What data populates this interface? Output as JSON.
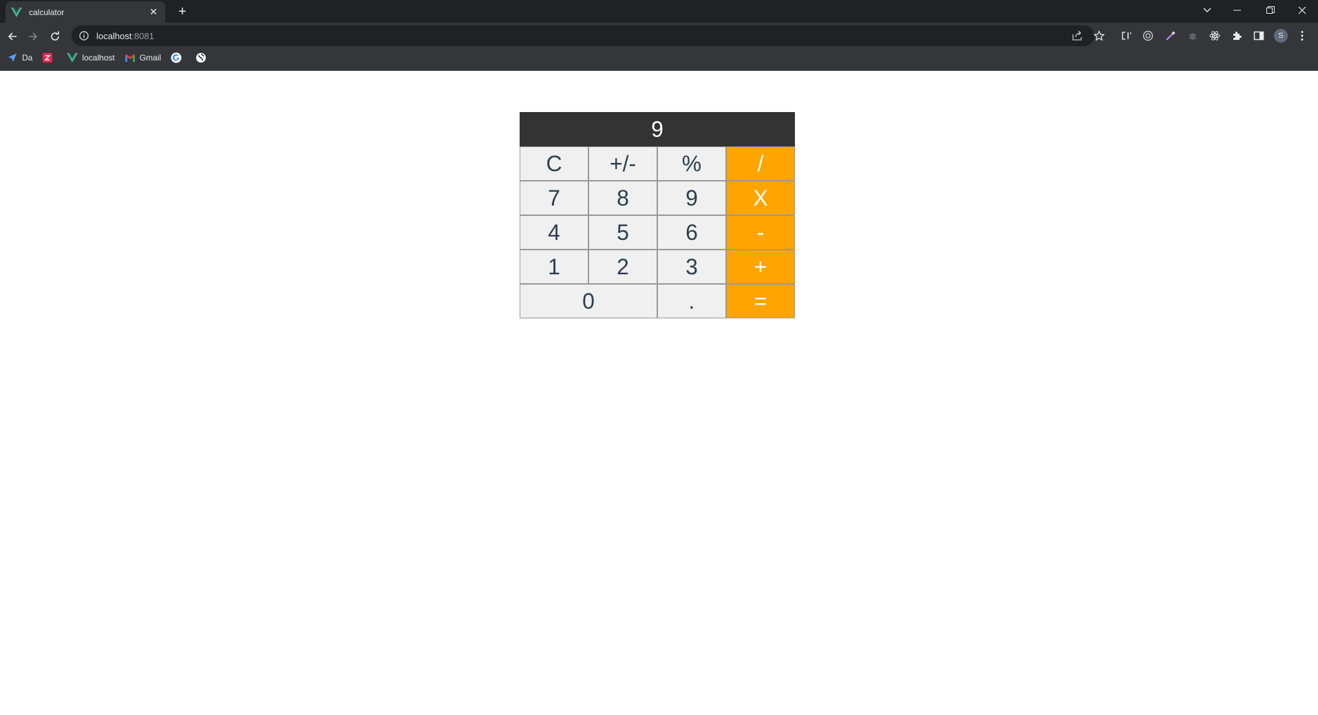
{
  "browser": {
    "tab": {
      "title": "calculator"
    },
    "address": {
      "host": "localhost",
      "port": ":8081"
    },
    "bookmarks": [
      {
        "label": "Da",
        "icon": "navigation-icon"
      },
      {
        "label": "",
        "icon": "z-app-icon"
      },
      {
        "label": "localhost",
        "icon": "vue-icon"
      },
      {
        "label": "Gmail",
        "icon": "gmail-icon"
      },
      {
        "label": "",
        "icon": "google-icon"
      },
      {
        "label": "",
        "icon": "globe-icon"
      }
    ],
    "profile_initial": "S"
  },
  "calculator": {
    "display": "9",
    "buttons": {
      "clear": "C",
      "sign": "+/-",
      "percent": "%",
      "divide": "/",
      "seven": "7",
      "eight": "8",
      "nine": "9",
      "multiply": "X",
      "four": "4",
      "five": "5",
      "six": "6",
      "minus": "-",
      "one": "1",
      "two": "2",
      "three": "3",
      "plus": "+",
      "zero": "0",
      "dot": ".",
      "equals": "="
    },
    "colors": {
      "display_bg": "#333333",
      "operator_bg": "#ffa500",
      "key_bg": "#f0f0f0"
    }
  }
}
